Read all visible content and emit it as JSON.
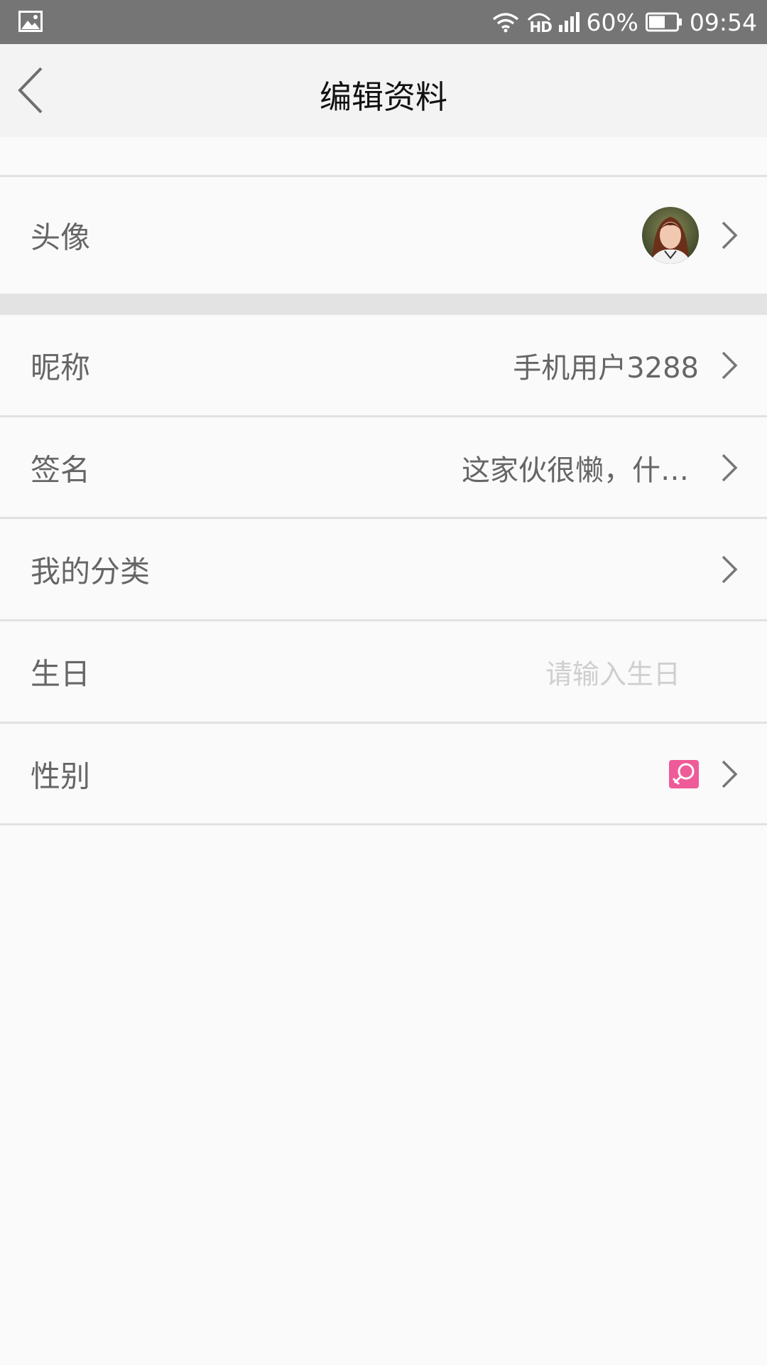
{
  "status_bar": {
    "battery_percent": "60%",
    "time": "09:54",
    "network_label": "HD",
    "icons": [
      "gallery-icon",
      "wifi-icon",
      "hd-call-icon",
      "signal-icon",
      "battery-icon"
    ]
  },
  "header": {
    "title": "编辑资料",
    "back_icon": "back-arrow-icon"
  },
  "profile": {
    "avatar_label": "头像",
    "nickname_label": "昵称",
    "nickname_value": "手机用户3288",
    "signature_label": "签名",
    "signature_value": "这家伙很懒，什…",
    "category_label": "我的分类",
    "birthday_label": "生日",
    "birthday_placeholder": "请输入生日",
    "gender_label": "性别",
    "gender_icon": "female-icon"
  },
  "colors": {
    "status_bar": "#757575",
    "header_bg": "#f3f3f3",
    "page_bg": "#fafafa",
    "gender_badge": "#ee5b98"
  }
}
